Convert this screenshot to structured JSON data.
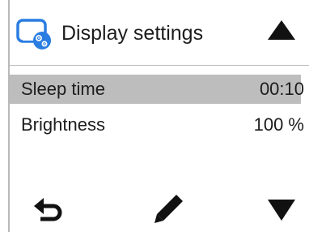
{
  "header": {
    "title": "Display settings",
    "icon": "display-settings-icon",
    "up_button": "triangle-up-icon"
  },
  "settings": [
    {
      "label": "Sleep time",
      "value": "00:10",
      "selected": true
    },
    {
      "label": "Brightness",
      "value": "100 %",
      "selected": false
    }
  ],
  "footer": {
    "back_icon": "back-arrow-icon",
    "edit_icon": "pencil-icon",
    "down_icon": "triangle-down-icon"
  },
  "colors": {
    "accent": "#2a7de1",
    "selected_row": "#bdbdbd",
    "text": "#1c1c1c"
  }
}
